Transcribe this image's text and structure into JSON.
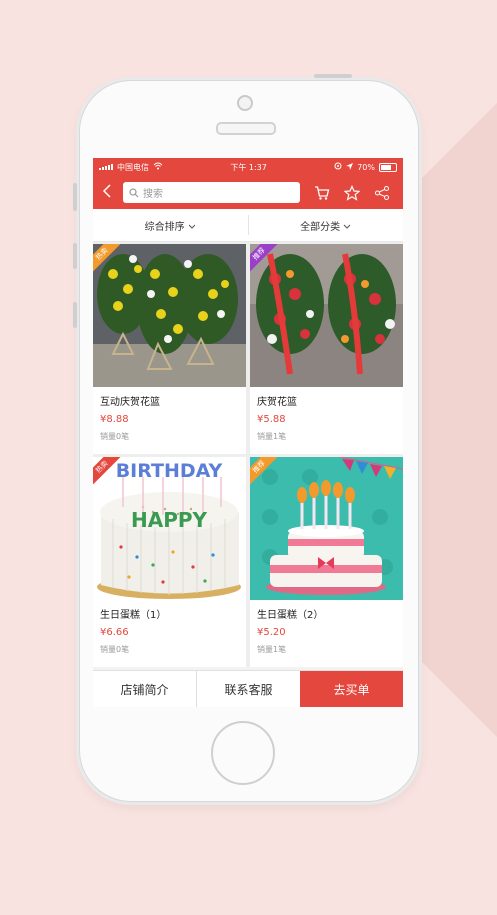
{
  "status_bar": {
    "carrier": "中国电信",
    "time": "下午 1:37",
    "battery": "70%"
  },
  "nav": {
    "search_placeholder": "搜索"
  },
  "filters": [
    {
      "label": "综合排序"
    },
    {
      "label": "全部分类"
    }
  ],
  "products": [
    {
      "name": "互动庆贺花篮",
      "price": "¥8.88",
      "sales": "销量0笔",
      "badge": "热卖"
    },
    {
      "name": "庆贺花篮",
      "price": "¥5.88",
      "sales": "销量1笔",
      "badge": "推荐"
    },
    {
      "name": "生日蛋糕（1）",
      "price": "¥6.66",
      "sales": "销量0笔",
      "badge": "热卖"
    },
    {
      "name": "生日蛋糕（2）",
      "price": "¥5.20",
      "sales": "销量1笔",
      "badge": "推荐"
    }
  ],
  "cake_text": {
    "line1": "BIRTHDAY",
    "line2": "HAPPY"
  },
  "bottom_bar": {
    "shop_intro": "店铺简介",
    "contact": "联系客服",
    "buy": "去买单"
  },
  "colors": {
    "accent": "#e4473d",
    "background": "#f9e3e1"
  }
}
